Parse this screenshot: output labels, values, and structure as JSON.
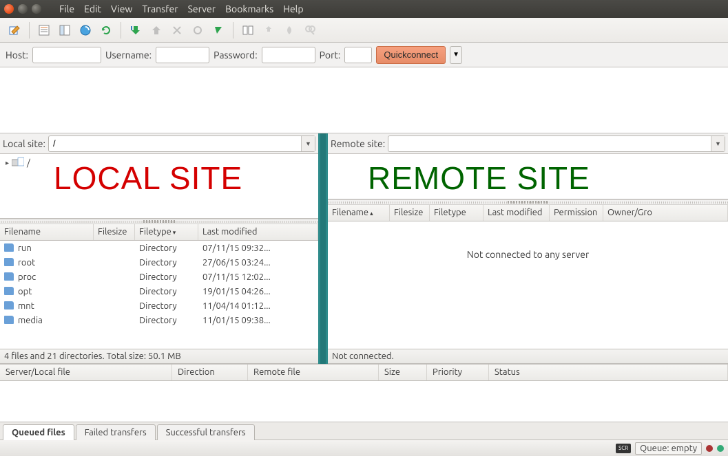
{
  "menu": {
    "file": "File",
    "edit": "Edit",
    "view": "View",
    "transfer": "Transfer",
    "server": "Server",
    "bookmarks": "Bookmarks",
    "help": "Help"
  },
  "quickconnect": {
    "host_label": "Host:",
    "user_label": "Username:",
    "pass_label": "Password:",
    "port_label": "Port:",
    "host": "",
    "user": "",
    "pass": "",
    "port": "",
    "button": "Quickconnect"
  },
  "local": {
    "label": "Local site:",
    "path": "/",
    "tree_root": "/",
    "annotation": "LOCAL SITE",
    "columns": {
      "name": "Filename",
      "size": "Filesize",
      "type": "Filetype",
      "modified": "Last modified"
    },
    "files": [
      {
        "name": "run",
        "size": "",
        "type": "Directory",
        "modified": "07/11/15 09:32..."
      },
      {
        "name": "root",
        "size": "",
        "type": "Directory",
        "modified": "27/06/15 03:24..."
      },
      {
        "name": "proc",
        "size": "",
        "type": "Directory",
        "modified": "07/11/15 12:02..."
      },
      {
        "name": "opt",
        "size": "",
        "type": "Directory",
        "modified": "19/01/15 04:26..."
      },
      {
        "name": "mnt",
        "size": "",
        "type": "Directory",
        "modified": "11/04/14 01:12..."
      },
      {
        "name": "media",
        "size": "",
        "type": "Directory",
        "modified": "11/01/15 09:38..."
      }
    ],
    "status": "4 files and 21 directories. Total size: 50.1 MB"
  },
  "remote": {
    "label": "Remote site:",
    "path": "",
    "annotation": "REMOTE SITE",
    "columns": {
      "name": "Filename",
      "size": "Filesize",
      "type": "Filetype",
      "modified": "Last modified",
      "perm": "Permission",
      "owner": "Owner/Gro"
    },
    "empty": "Not connected to any server",
    "status": "Not connected."
  },
  "queue": {
    "columns": {
      "server": "Server/Local file",
      "dir": "Direction",
      "remote": "Remote file",
      "size": "Size",
      "prio": "Priority",
      "status": "Status"
    }
  },
  "tabs": {
    "queued": "Queued files",
    "failed": "Failed transfers",
    "success": "Successful transfers"
  },
  "statusbar": {
    "queue": "Queue: empty"
  }
}
